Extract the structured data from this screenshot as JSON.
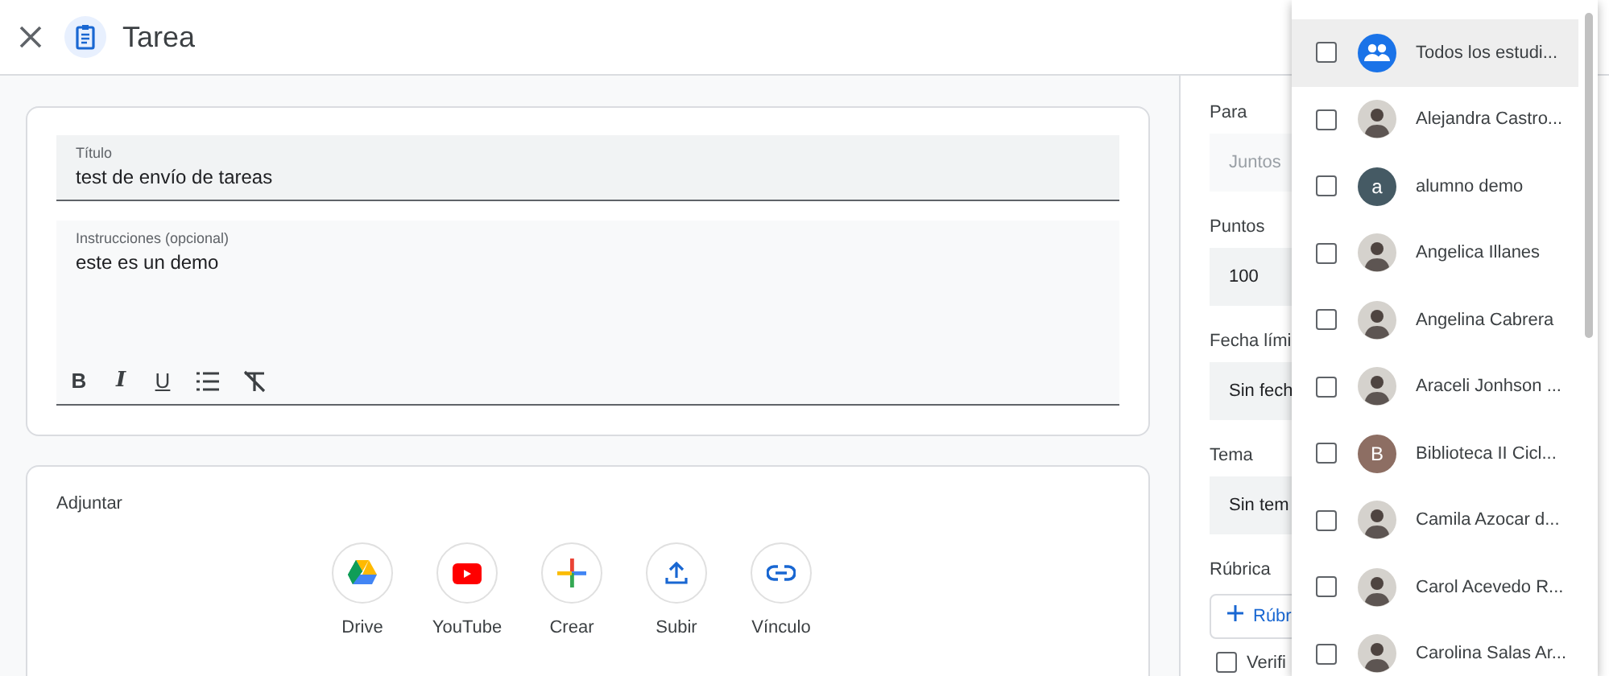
{
  "header": {
    "title": "Tarea"
  },
  "title_field": {
    "label": "Título",
    "value": "test de envío de tareas"
  },
  "instructions_field": {
    "label": "Instrucciones (opcional)",
    "value": "este es un demo",
    "tools": [
      {
        "kind": "bold",
        "label": "B"
      },
      {
        "kind": "italic",
        "label": "I"
      },
      {
        "kind": "underline",
        "label": "U"
      },
      {
        "kind": "list"
      },
      {
        "kind": "clear"
      }
    ]
  },
  "attach": {
    "title": "Adjuntar",
    "options": [
      {
        "kind": "drive",
        "label": "Drive"
      },
      {
        "kind": "youtube",
        "label": "YouTube"
      },
      {
        "kind": "create",
        "label": "Crear"
      },
      {
        "kind": "upload",
        "label": "Subir"
      },
      {
        "kind": "link",
        "label": "Vínculo"
      }
    ]
  },
  "side": {
    "fields": [
      {
        "label": "Para",
        "placeholder": "Juntos"
      },
      {
        "label": "Puntos",
        "value": "100"
      },
      {
        "label": "Fecha lími",
        "value": "Sin fech"
      },
      {
        "label": "Tema",
        "value": "Sin tem"
      }
    ],
    "rubric": {
      "label": "Rúbrica",
      "button": "Rúbr"
    },
    "check": {
      "label": "Verifi",
      "checked": false
    }
  },
  "dropdown": {
    "items": [
      {
        "name": "Todos los estudi...",
        "kind": "group",
        "checked": false,
        "selected": true
      },
      {
        "name": "Alejandra Castro...",
        "kind": "photo",
        "checked": false,
        "selected": false
      },
      {
        "name": "alumno demo",
        "kind": "letter",
        "letter": "a",
        "color": "#455a64",
        "checked": false,
        "selected": false
      },
      {
        "name": "Angelica Illanes",
        "kind": "photo",
        "checked": false,
        "selected": false
      },
      {
        "name": "Angelina Cabrera",
        "kind": "photo",
        "checked": false,
        "selected": false
      },
      {
        "name": "Araceli Jonhson ...",
        "kind": "photo",
        "checked": false,
        "selected": false
      },
      {
        "name": "Biblioteca II Cicl...",
        "kind": "letter",
        "letter": "B",
        "color": "#8d6e63",
        "checked": false,
        "selected": false
      },
      {
        "name": "Camila Azocar d...",
        "kind": "photo",
        "checked": false,
        "selected": false
      },
      {
        "name": "Carol Acevedo R...",
        "kind": "photo",
        "checked": false,
        "selected": false
      },
      {
        "name": "Carolina Salas Ar...",
        "kind": "photo",
        "checked": false,
        "selected": false
      }
    ]
  }
}
